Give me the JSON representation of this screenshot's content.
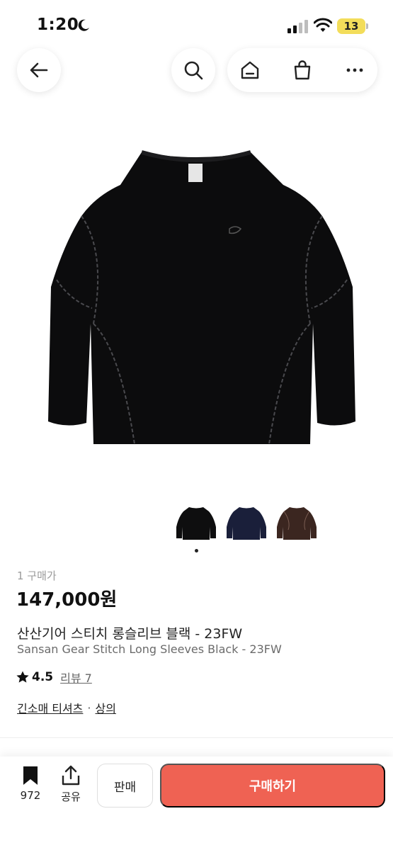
{
  "status_bar": {
    "time": "1:20",
    "battery": "13"
  },
  "nav": {
    "icons": [
      "back-arrow-icon",
      "search-icon",
      "home-icon",
      "shopping-bag-icon",
      "more-icon"
    ]
  },
  "product": {
    "purchase_count": "1 구매가",
    "price": "147,000원",
    "title_ko": "산산기어 스티치 롱슬리브 블랙 - 23FW",
    "title_en": "Sansan Gear Stitch Long Sleeves Black - 23FW",
    "rating": "4.5",
    "review_label": "리뷰 7",
    "category_primary": "긴소매 티셔츠",
    "category_separator": "·",
    "category_secondary": "상의",
    "thumbnails": [
      {
        "color_name": "black",
        "color": "#0e0e0f"
      },
      {
        "color_name": "navy",
        "color": "#1a1f3a"
      },
      {
        "color_name": "brown",
        "color": "#3b2620"
      }
    ]
  },
  "bottom_bar": {
    "bookmark_count": "972",
    "share_label": "공유",
    "sell_label": "판매",
    "buy_label": "구매하기"
  },
  "colors": {
    "accent": "#ef6253"
  }
}
